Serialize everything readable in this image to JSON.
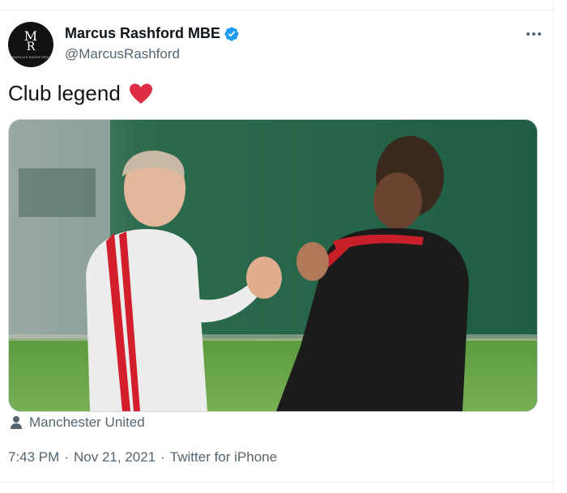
{
  "tweet": {
    "author": {
      "display_name": "Marcus Rashford MBE",
      "handle": "@MarcusRashford",
      "verified": true,
      "avatar_monogram_top": "M",
      "avatar_monogram_bottom": "R",
      "avatar_tagline": "MARCUS RASHFORD"
    },
    "text": "Club legend",
    "emoji": "red-heart",
    "location": "Manchester United",
    "timestamp": "7:43 PM",
    "date": "Nov 21, 2021",
    "source": "Twitter for iPhone",
    "separator": "·"
  },
  "colors": {
    "verified": "#1d9bf0",
    "heart": "#dd2e44",
    "secondary_text": "#536471",
    "primary_text": "#0f1419",
    "border": "#cfd9de"
  },
  "icons": {
    "verified": "verified-badge-icon",
    "more": "more-options-icon",
    "heart": "heart-emoji-icon",
    "location": "person-icon"
  }
}
